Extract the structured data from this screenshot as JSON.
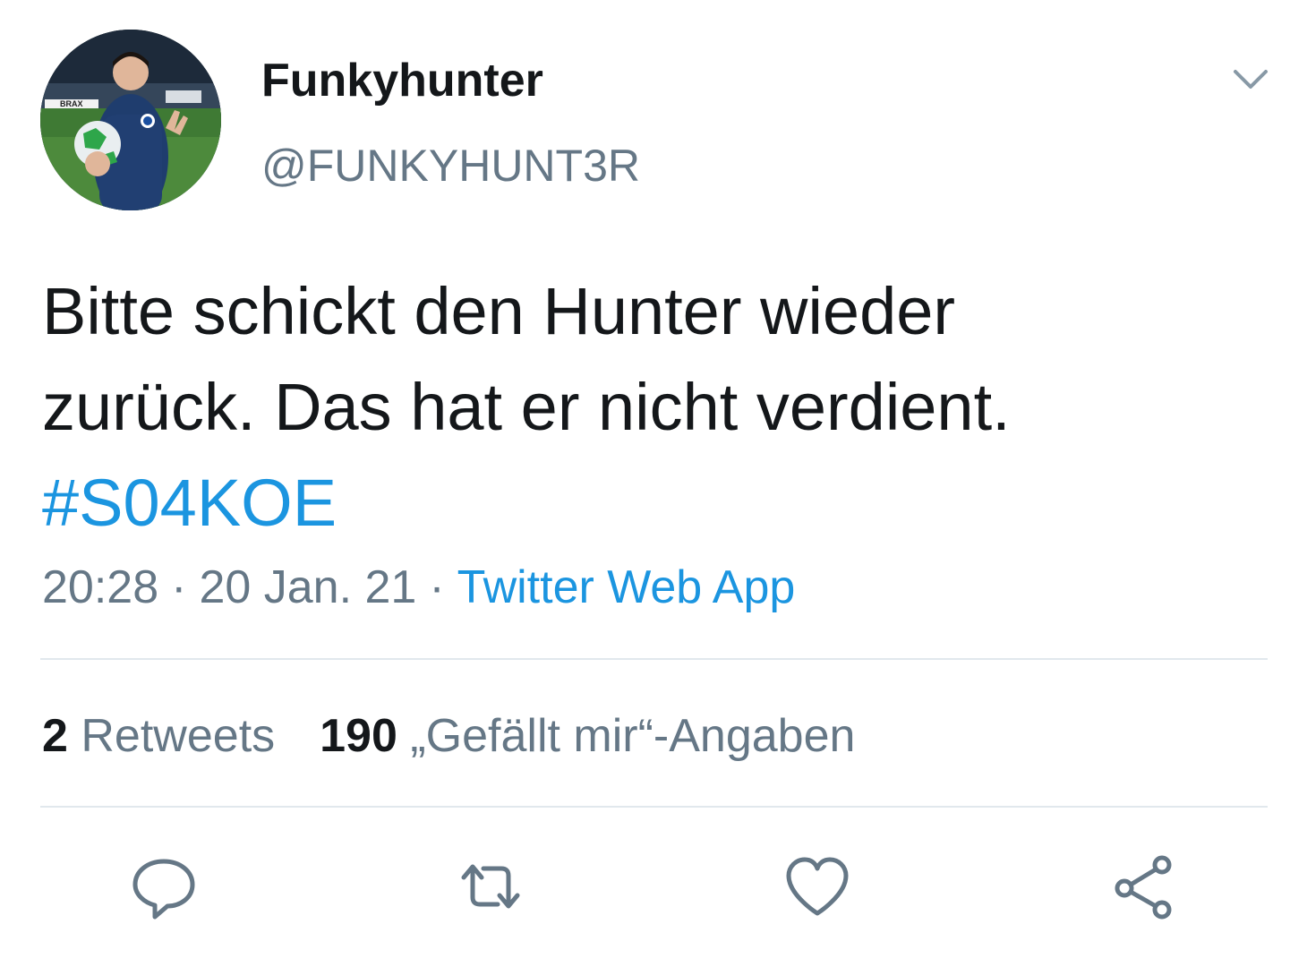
{
  "tweet": {
    "display_name": "Funkyhunter",
    "handle": "@FUNKYHUNT3R",
    "text_line1": "Bitte schickt den Hunter wieder",
    "text_line2": "zurück. Das hat er nicht verdient.",
    "hashtag": "#S04KOE",
    "time": "20:28",
    "date": "20 Jan. 21",
    "separator": "·",
    "source": "Twitter Web App",
    "avatar_banner_text": "BRAX"
  },
  "stats": {
    "retweets_count": "2",
    "retweets_label": "Retweets",
    "likes_count": "190",
    "likes_label": "„Gefällt mir“-Angaben"
  },
  "actions": [
    "reply-icon",
    "retweet-icon",
    "like-icon",
    "share-icon"
  ],
  "colors": {
    "text": "#14171a",
    "secondary": "#657786",
    "link": "#1b95e0",
    "divider": "#e1e8ed"
  }
}
